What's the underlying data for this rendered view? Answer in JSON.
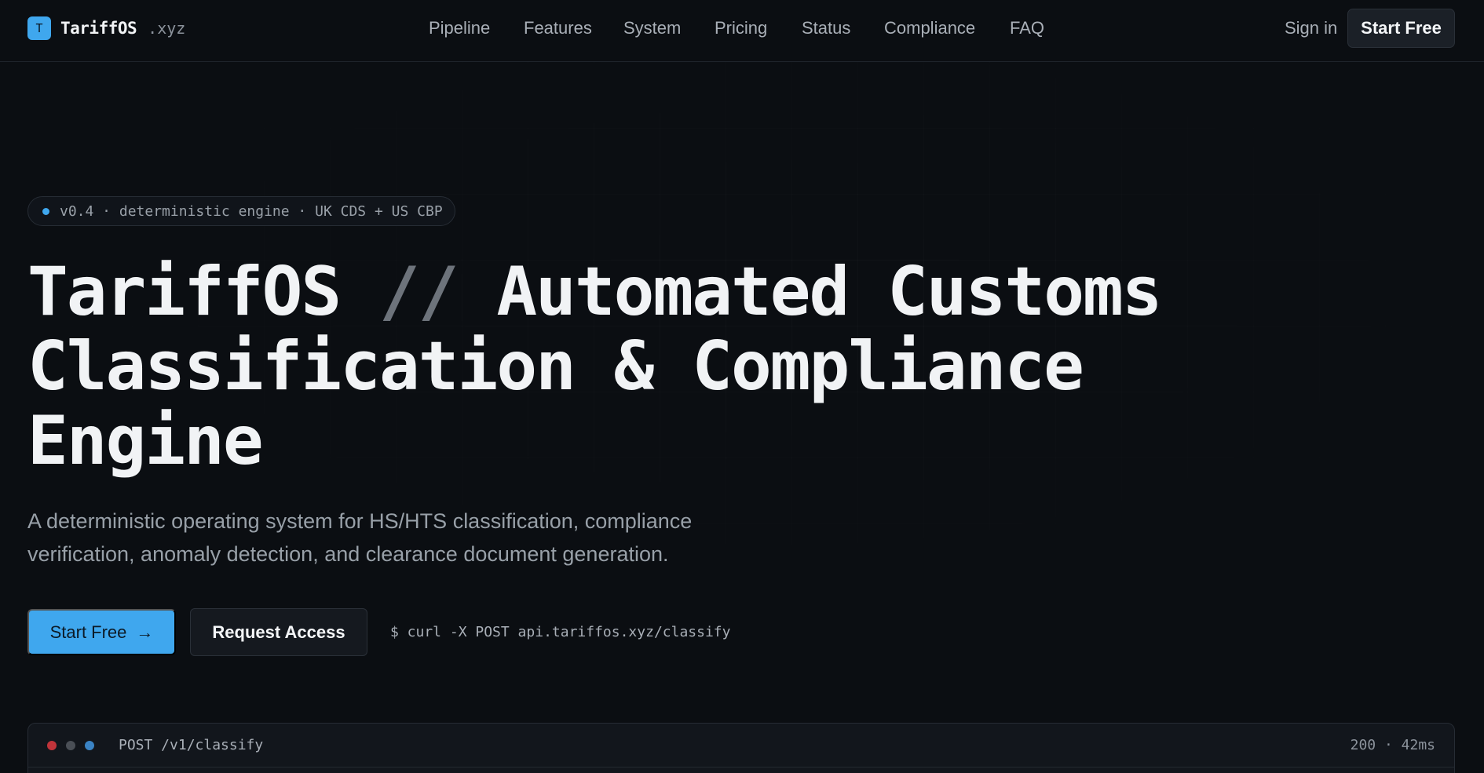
{
  "brand": {
    "logo_letter": "T",
    "name": "TariffOS",
    "tld": ".xyz"
  },
  "nav": {
    "items": [
      "Pipeline",
      "Features",
      "System",
      "Pricing",
      "Status",
      "Compliance",
      "FAQ"
    ],
    "signin": "Sign in",
    "start_free": "Start Free"
  },
  "hero": {
    "badge": "v0.4 · deterministic engine · UK CDS + US CBP",
    "title_part1": "TariffOS ",
    "title_slashes": "//",
    "title_part2": " Automated Customs Classification & Compliance Engine",
    "subtitle": "A deterministic operating system for HS/HTS classification, compliance verification, anomaly detection, and clearance document generation.",
    "cta_primary": "Start Free",
    "cta_primary_arrow": "→",
    "cta_secondary": "Request Access",
    "curl": "$ curl -X POST api.tariffos.xyz/classify"
  },
  "terminal": {
    "title": "POST /v1/classify",
    "status": "200 · 42ms"
  },
  "colors": {
    "accent": "#3fa7ee",
    "background": "#0b0e12",
    "window_dot_red": "#c0343a",
    "window_dot_gray": "#4a4f56",
    "window_dot_blue": "#3a83c4"
  }
}
